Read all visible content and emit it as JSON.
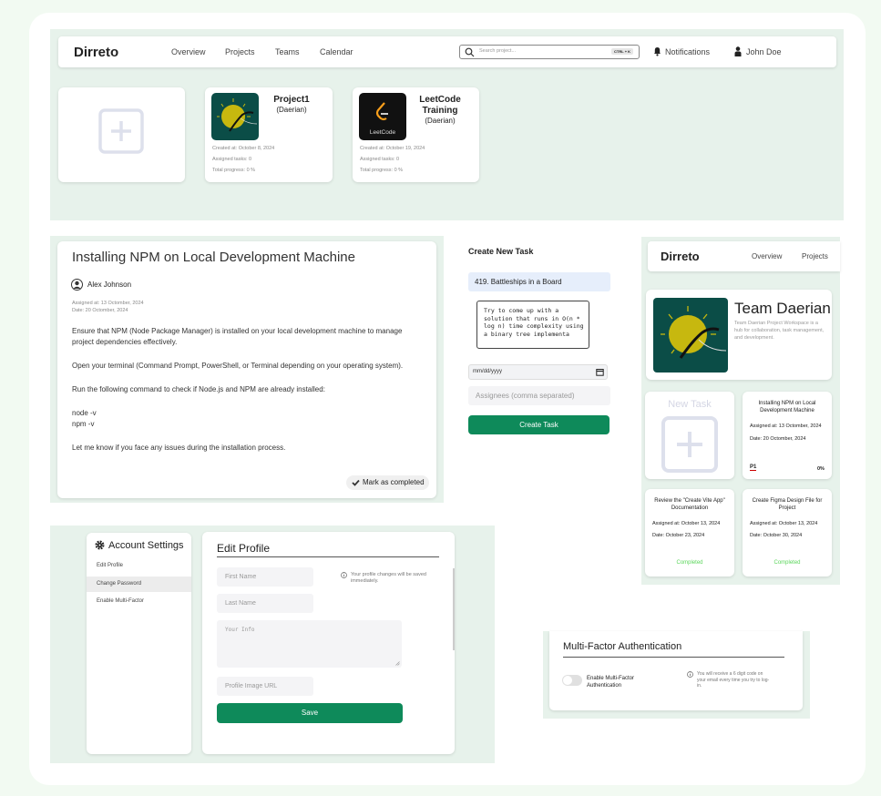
{
  "nav": {
    "brand": "Dirreto",
    "links": [
      "Overview",
      "Projects",
      "Teams",
      "Calendar"
    ],
    "search_placeholder": "Search project...",
    "shortcut": "CTRL + K",
    "notifications": "Notifications",
    "user": "John Doe"
  },
  "projects": [
    {
      "title": "Project1",
      "owner": "(Daerian)",
      "created": "Created at: October 8, 2024",
      "tasks": "Assigned tasks: 0",
      "progress": "Total progress: 0 %"
    },
    {
      "title": "LeetCode Training",
      "owner": "(Daerian)",
      "logo_text": "LeetCode",
      "created": "Created at: October 19, 2024",
      "tasks": "Assigned tasks: 0",
      "progress": "Total progress: 0 %"
    }
  ],
  "task": {
    "title": "Installing NPM on Local Development Machine",
    "author": "Alex Johnson",
    "assigned": "Assigned at: 13 Octomber, 2024",
    "due": "Date: 20 Octomber, 2024",
    "paragraphs": [
      "Ensure that NPM (Node Package Manager) is installed on your local development machine to manage project dependencies effectively.",
      "Open your terminal (Command Prompt, PowerShell, or Terminal depending on your operating system).",
      "Run the following command to check if Node.js and NPM are already installed:",
      "node -v",
      "npm -v",
      "Let me know if you face any issues during the installation process."
    ],
    "complete_label": "Mark as completed"
  },
  "create_task": {
    "heading": "Create New Task",
    "title_value": "419. Battleships in a Board",
    "description_value": "Try to come up with a solution that runs in O(n * log n) time complexity using a binary tree implementa",
    "date_placeholder": "mm/dd/yyyy",
    "assignees_placeholder": "Assignees (comma separated)",
    "submit": "Create Task"
  },
  "team": {
    "brand": "Dirreto",
    "nav": [
      "Overview",
      "Projects"
    ],
    "name": "Team Daerian",
    "description": "Team Daerian Project Workspace is a hub for collaboration, task management, and development.",
    "new_task": "New Task",
    "tasks": [
      {
        "title": "Installing NPM on Local Development Machine",
        "assigned": "Assigned at: 13 Octomber, 2024",
        "due": "Date: 20 Octomber, 2024",
        "priority": "P1",
        "progress": "0%"
      },
      {
        "title": "Review the \"Create Vite App\" Documentation",
        "assigned": "Assigned at: October 13, 2024",
        "due": "Date: October 23, 2024",
        "status": "Completed"
      },
      {
        "title": "Create Figma Design File for Project",
        "assigned": "Assigned at: October 13, 2024",
        "due": "Date: October 30, 2024",
        "status": "Completed"
      }
    ]
  },
  "settings": {
    "heading": "Account Settings",
    "menu": [
      "Edit Profile",
      "Change Password",
      "Enable Multi-Factor"
    ],
    "form_title": "Edit Profile",
    "first_name": "First Name",
    "last_name": "Last Name",
    "info": "Your Info",
    "image_url": "Profile Image URL",
    "note": "Your profile changes will be saved immediately.",
    "save": "Save"
  },
  "mfa": {
    "title": "Multi-Factor Authentication",
    "toggle_label": "Enable Multi-Factor Authentication",
    "note": "You will receive a 6 digit code on your email every time you try to log-in."
  },
  "colors": {
    "accent": "#0e8a5a",
    "completed": "#5bd65b",
    "logo_bg": "#0b4d47",
    "sun": "#c7b80f"
  }
}
